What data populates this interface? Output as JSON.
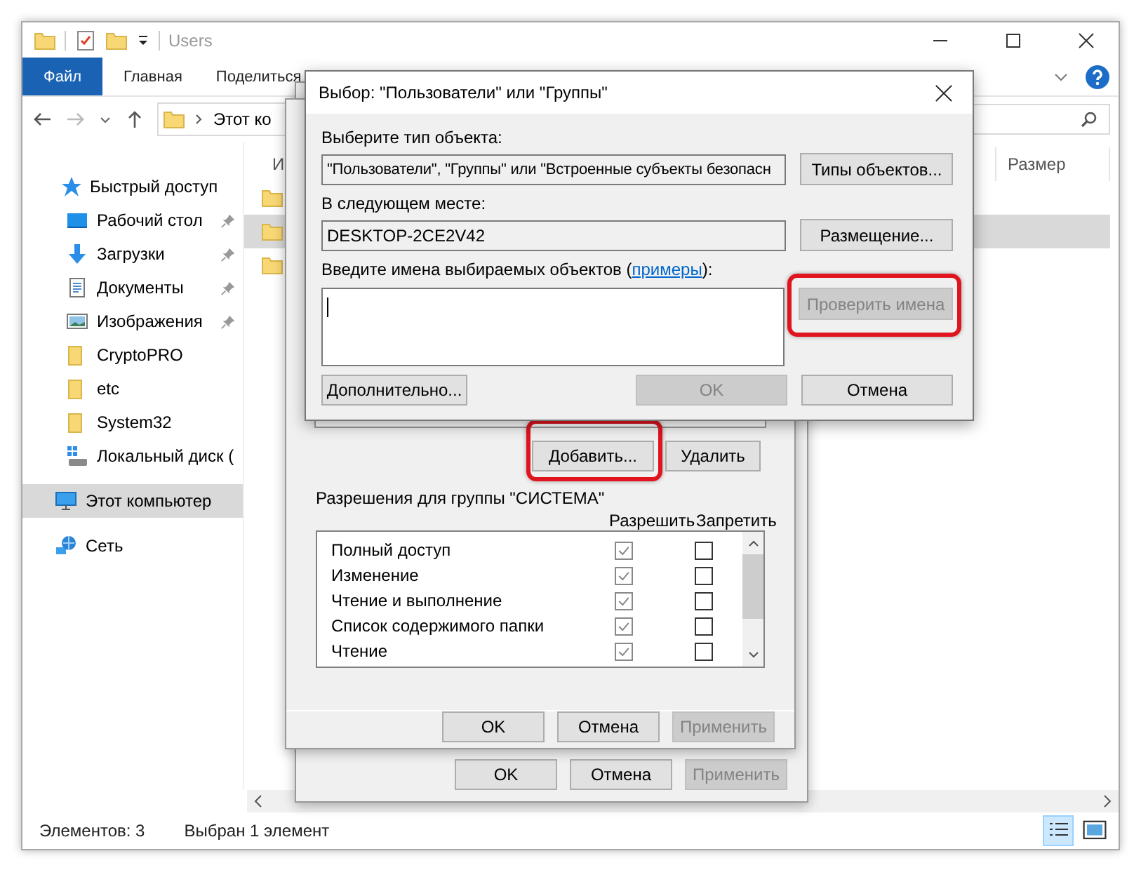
{
  "explorer": {
    "title": "Users",
    "ribbon_tabs": [
      {
        "label": "Файл",
        "selected": true
      },
      {
        "label": "Главная",
        "selected": false
      },
      {
        "label": "Поделиться",
        "selected": false
      }
    ],
    "address": "Этот ко",
    "column_1": "И",
    "size_column": "Размер",
    "rows": [
      {
        "selected": false
      },
      {
        "selected": true
      },
      {
        "selected": false
      }
    ],
    "sidebar": [
      {
        "label": "Быстрый доступ",
        "kind": "star",
        "pinned": false,
        "selected": false
      },
      {
        "label": "Рабочий стол",
        "kind": "desktop",
        "pinned": true,
        "selected": false
      },
      {
        "label": "Загрузки",
        "kind": "download",
        "pinned": true,
        "selected": false
      },
      {
        "label": "Документы",
        "kind": "document",
        "pinned": true,
        "selected": false
      },
      {
        "label": "Изображения",
        "kind": "image",
        "pinned": true,
        "selected": false
      },
      {
        "label": "CryptoPRO",
        "kind": "folder",
        "pinned": false,
        "selected": false
      },
      {
        "label": "etc",
        "kind": "folder",
        "pinned": false,
        "selected": false
      },
      {
        "label": "System32",
        "kind": "folder",
        "pinned": false,
        "selected": false
      },
      {
        "label": "Локальный диск (",
        "kind": "drive",
        "pinned": false,
        "selected": false
      },
      {
        "label": "Этот компьютер",
        "kind": "computer",
        "pinned": false,
        "selected": true
      },
      {
        "label": "Сеть",
        "kind": "network",
        "pinned": false,
        "selected": false
      }
    ],
    "status": [
      "Элементов: 3",
      "Выбран 1 элемент"
    ]
  },
  "properties_back": {
    "buttons": [
      {
        "label": "OK",
        "disabled": false
      },
      {
        "label": "Отмена",
        "disabled": false
      },
      {
        "label": "Применить",
        "disabled": true
      }
    ]
  },
  "properties": {
    "group_buttons": [
      {
        "label": "Добавить...",
        "highlight": true
      },
      {
        "label": "Удалить"
      }
    ],
    "permissions_title": "Разрешения для группы \"СИСТЕМА\"",
    "allow_header": "Разрешить",
    "deny_header": "Запретить",
    "permissions": [
      {
        "name": "Полный доступ",
        "allow": true,
        "deny": false
      },
      {
        "name": "Изменение",
        "allow": true,
        "deny": false
      },
      {
        "name": "Чтение и выполнение",
        "allow": true,
        "deny": false
      },
      {
        "name": "Список содержимого папки",
        "allow": true,
        "deny": false
      },
      {
        "name": "Чтение",
        "allow": true,
        "deny": false
      }
    ],
    "buttons": [
      {
        "label": "OK",
        "disabled": false
      },
      {
        "label": "Отмена",
        "disabled": false
      },
      {
        "label": "Применить",
        "disabled": true
      }
    ]
  },
  "select_dialog": {
    "title": "Выбор: \"Пользователи\" или \"Группы\"",
    "object_type_label": "Выберите тип объекта:",
    "object_type": "\"Пользователи\", \"Группы\" или \"Встроенные субъекты безопасн",
    "object_types_button": "Типы объектов...",
    "location_label": "В следующем месте:",
    "location": "DESKTOP-2CE2V42",
    "locations_button": "Размещение...",
    "names_label": "Введите имена выбираемых объектов (",
    "names_link": "примеры",
    "names_label_end": "):",
    "check_button": {
      "label": "Проверить имена",
      "disabled": true,
      "highlight": true
    },
    "advanced_button": "Дополнительно...",
    "ok": {
      "label": "OK",
      "disabled": true
    },
    "cancel": "Отмена"
  }
}
